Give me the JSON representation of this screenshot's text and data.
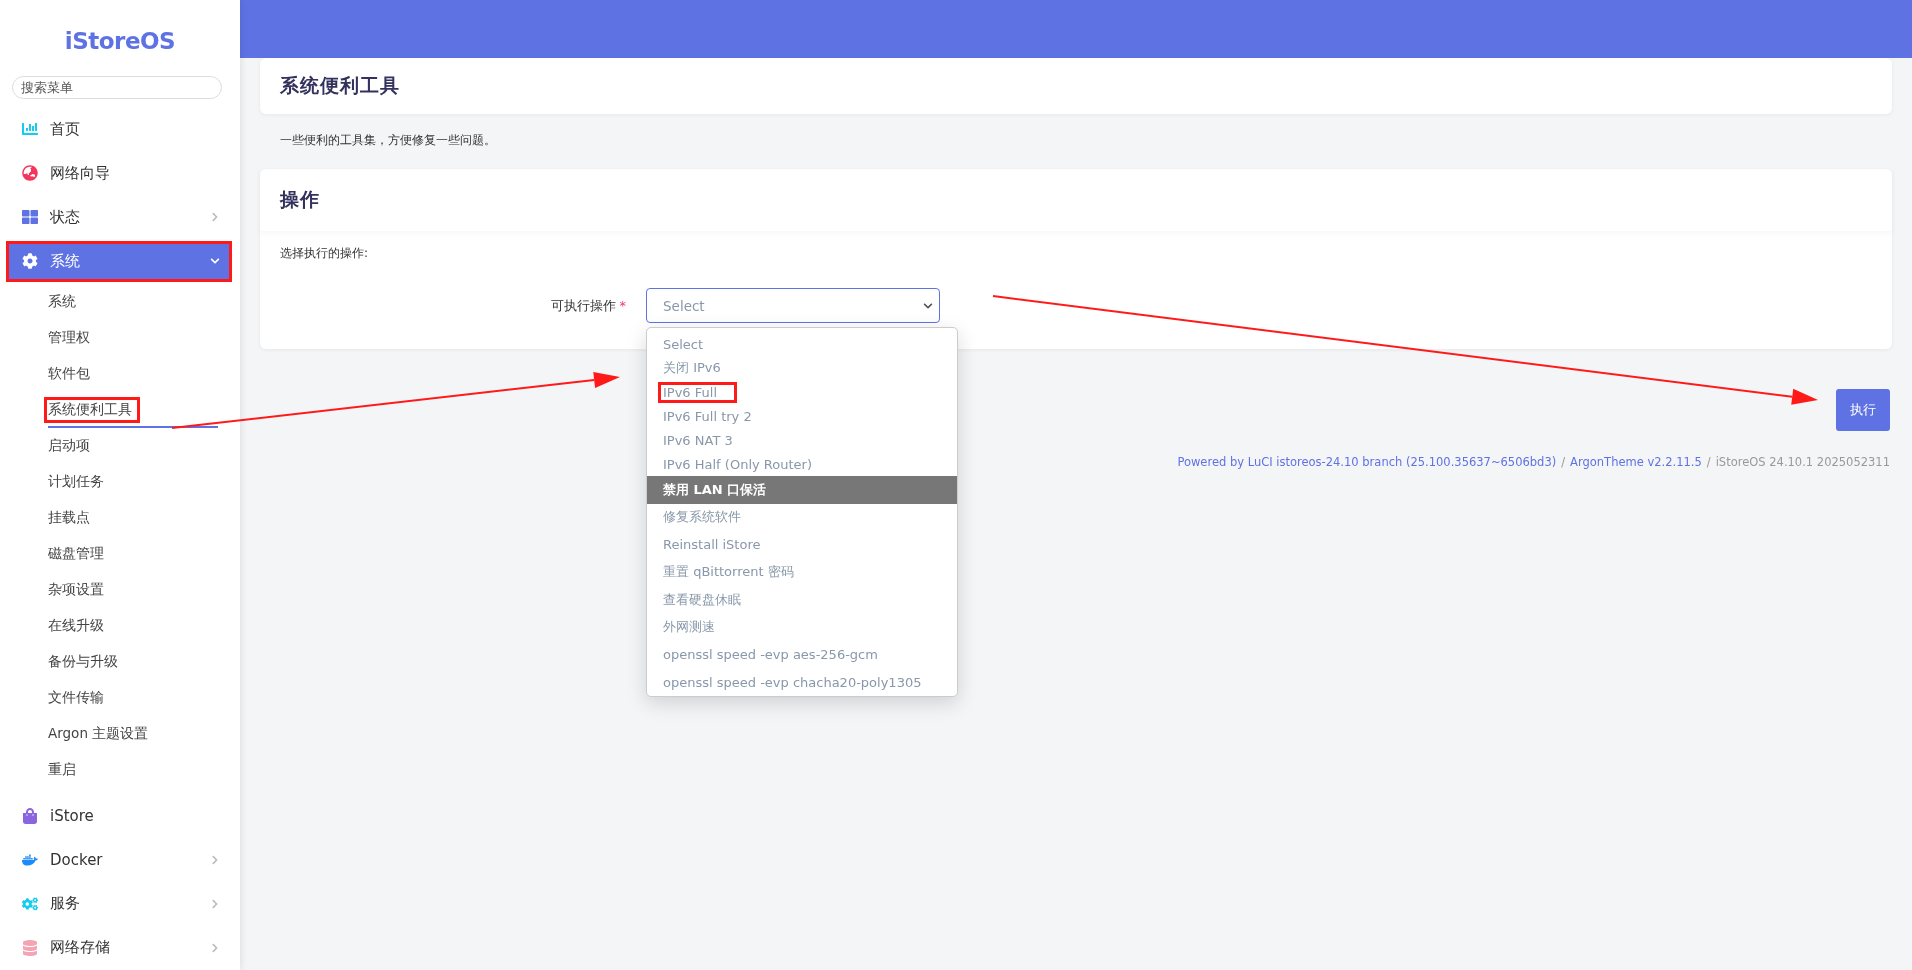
{
  "sidebar": {
    "logo": "iStoreOS",
    "search": {
      "placeholder": "搜索菜单"
    },
    "items": [
      {
        "label": "首页",
        "has_children": false,
        "expanded": false,
        "selected": false,
        "annotated": false
      },
      {
        "label": "网络向导",
        "has_children": false,
        "expanded": false,
        "selected": false,
        "annotated": false
      },
      {
        "label": "状态",
        "has_children": true,
        "expanded": false,
        "selected": false,
        "annotated": false
      },
      {
        "label": "系统",
        "has_children": true,
        "expanded": true,
        "selected": true,
        "annotated": true,
        "children": [
          {
            "label": "系统",
            "selected": false,
            "annotated": false
          },
          {
            "label": "管理权",
            "selected": false,
            "annotated": false
          },
          {
            "label": "软件包",
            "selected": false,
            "annotated": false
          },
          {
            "label": "系统便利工具",
            "selected": true,
            "annotated": true
          },
          {
            "label": "启动项",
            "selected": false,
            "annotated": false
          },
          {
            "label": "计划任务",
            "selected": false,
            "annotated": false
          },
          {
            "label": "挂载点",
            "selected": false,
            "annotated": false
          },
          {
            "label": "磁盘管理",
            "selected": false,
            "annotated": false
          },
          {
            "label": "杂项设置",
            "selected": false,
            "annotated": false
          },
          {
            "label": "在线升级",
            "selected": false,
            "annotated": false
          },
          {
            "label": "备份与升级",
            "selected": false,
            "annotated": false
          },
          {
            "label": "文件传输",
            "selected": false,
            "annotated": false
          },
          {
            "label": "Argon 主题设置",
            "selected": false,
            "annotated": false
          },
          {
            "label": "重启",
            "selected": false,
            "annotated": false
          }
        ]
      },
      {
        "label": "iStore",
        "has_children": false,
        "expanded": false,
        "selected": false,
        "annotated": false
      },
      {
        "label": "Docker",
        "has_children": true,
        "expanded": false,
        "selected": false,
        "annotated": false
      },
      {
        "label": "服务",
        "has_children": true,
        "expanded": false,
        "selected": false,
        "annotated": false
      },
      {
        "label": "网络存储",
        "has_children": true,
        "expanded": false,
        "selected": false,
        "annotated": false
      }
    ]
  },
  "page": {
    "title": "系统便利工具",
    "description": "一些便利的工具集，方便修复一些问题。",
    "section": {
      "title": "操作",
      "subtitle": "选择执行的操作:",
      "field": {
        "label": "可执行操作",
        "required_mark": "*",
        "value": "Select",
        "open": true,
        "options": [
          {
            "label": "Select",
            "highlighted": false,
            "annotated": false
          },
          {
            "label": "关闭 IPv6",
            "highlighted": false,
            "annotated": false
          },
          {
            "label": "IPv6 Full",
            "highlighted": false,
            "annotated": true
          },
          {
            "label": "IPv6 Full try 2",
            "highlighted": false,
            "annotated": false
          },
          {
            "label": "IPv6 NAT 3",
            "highlighted": false,
            "annotated": false
          },
          {
            "label": "IPv6 Half (Only Router)",
            "highlighted": false,
            "annotated": false
          },
          {
            "label": "禁用 LAN 口保活",
            "highlighted": true,
            "annotated": false
          },
          {
            "label": "修复系统软件",
            "highlighted": false,
            "annotated": false
          },
          {
            "label": "Reinstall iStore",
            "highlighted": false,
            "annotated": false
          },
          {
            "label": "重置 qBittorrent 密码",
            "highlighted": false,
            "annotated": false
          },
          {
            "label": "查看硬盘休眠",
            "highlighted": false,
            "annotated": false
          },
          {
            "label": "外网测速",
            "highlighted": false,
            "annotated": false
          },
          {
            "label": "openssl speed -evp aes-256-gcm",
            "highlighted": false,
            "annotated": false
          },
          {
            "label": "openssl speed -evp chacha20-poly1305",
            "highlighted": false,
            "annotated": false
          }
        ]
      }
    },
    "execute_button": "执行",
    "footer": {
      "powered_by": "Powered by LuCI istoreos-24.10 branch (25.100.35637~6506bd3)",
      "separator_1": "/",
      "theme": "ArgonTheme v2.2.11.5",
      "separator_2": "/",
      "version": "iStoreOS 24.10.1 2025052311"
    }
  }
}
